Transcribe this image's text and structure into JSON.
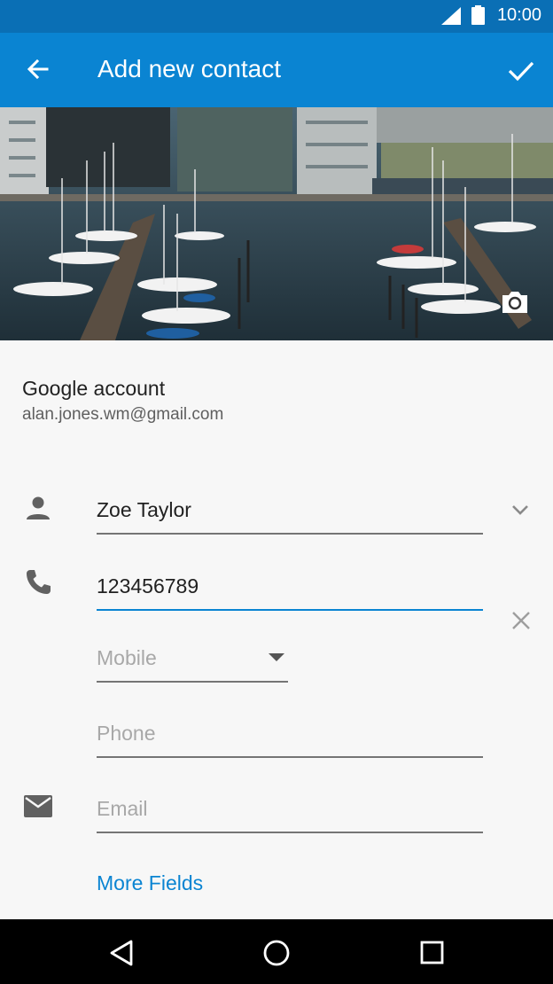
{
  "status_bar": {
    "time": "10:00",
    "icons": [
      "signal-icon",
      "battery-icon"
    ]
  },
  "app_bar": {
    "title": "Add new contact",
    "back_icon": "arrow-back-icon",
    "done_icon": "check-icon"
  },
  "photo": {
    "camera_icon": "camera-icon"
  },
  "account": {
    "label": "Google account",
    "email": "alan.jones.wm@gmail.com"
  },
  "form": {
    "name": {
      "value": "Zoe Taylor",
      "icon": "person-icon",
      "expand_icon": "chevron-down-icon"
    },
    "phone": {
      "value": "123456789",
      "icon": "phone-icon",
      "clear_icon": "close-icon"
    },
    "phone_type": {
      "selected": "Mobile",
      "icon": "dropdown-arrow-icon"
    },
    "phone2": {
      "placeholder": "Phone"
    },
    "email": {
      "placeholder": "Email",
      "icon": "email-icon"
    },
    "more_fields": "More Fields"
  },
  "nav_bar": {
    "buttons": [
      "back-triangle-icon",
      "home-circle-icon",
      "recents-square-icon"
    ]
  },
  "colors": {
    "primary": "#0a84d2",
    "primary_dark": "#0a6fb5",
    "background": "#f7f7f7"
  }
}
